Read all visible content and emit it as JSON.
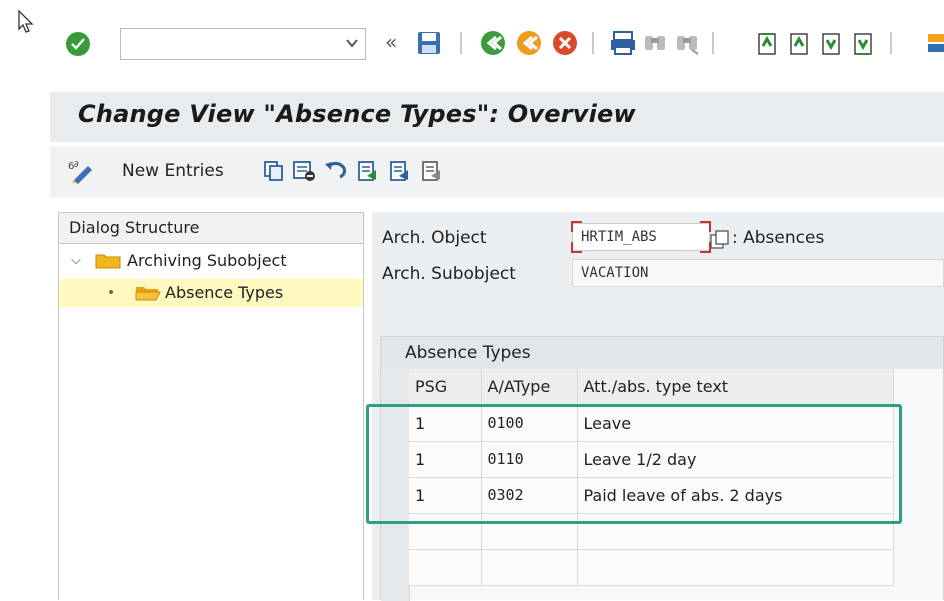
{
  "toolbar": {
    "command_value": "",
    "icons": [
      "enter-icon",
      "save-icon",
      "back-icon",
      "exit-icon",
      "cancel-icon",
      "print-icon",
      "find-icon",
      "find-next-icon",
      "first-page-icon",
      "prev-page-icon",
      "next-page-icon",
      "last-page-icon"
    ]
  },
  "title": "Change View \"Absence Types\": Overview",
  "app_toolbar": {
    "new_entries": "New Entries"
  },
  "dialog_structure": {
    "header": "Dialog Structure",
    "items": [
      {
        "label": "Archiving Subobject",
        "expanded": true,
        "selected": false
      },
      {
        "label": "Absence Types",
        "expanded": false,
        "selected": true
      }
    ]
  },
  "fields": {
    "arch_object": {
      "label": "Arch. Object",
      "value": "HRTIM_ABS",
      "description": ": Absences"
    },
    "arch_subobject": {
      "label": "Arch. Subobject",
      "value": "VACATION"
    }
  },
  "table": {
    "caption": "Absence Types",
    "columns": [
      "PSG",
      "A/AType",
      "Att./abs. type text"
    ],
    "rows": [
      [
        "1",
        "0100",
        "Leave"
      ],
      [
        "1",
        "0110",
        "Leave 1/2 day"
      ],
      [
        "1",
        "0302",
        "Paid leave of abs. 2 days"
      ]
    ]
  },
  "colors": {
    "highlight": "#2aa184",
    "selected_row": "#fff8bf",
    "folder": "#f2b51e"
  }
}
